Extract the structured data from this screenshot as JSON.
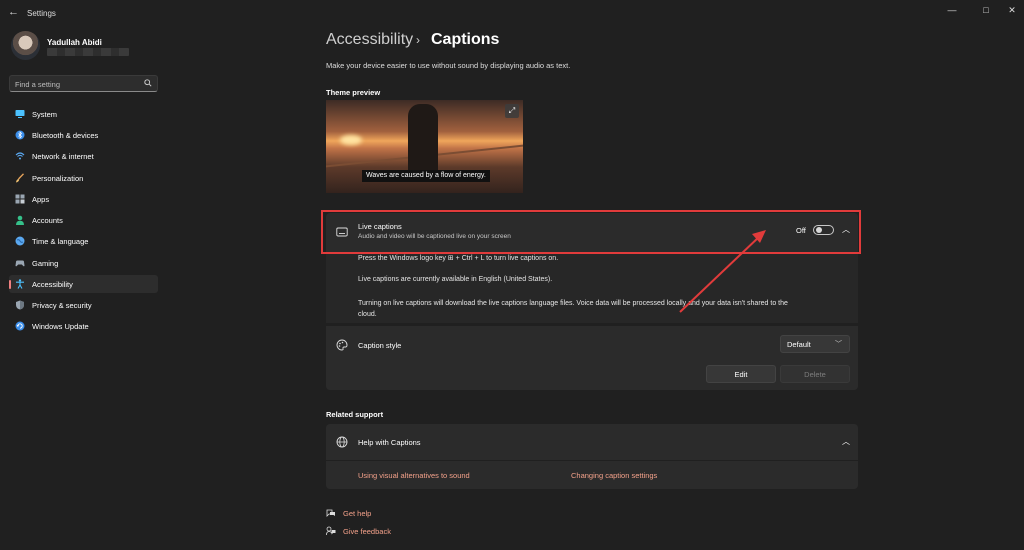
{
  "window": {
    "title": "Settings",
    "controls": {
      "minimize": "—",
      "maximize": "□",
      "close": "✕"
    }
  },
  "profile": {
    "name": "Yadullah Abidi"
  },
  "search": {
    "placeholder": "Find a setting",
    "icon": "search-icon"
  },
  "sidebar": {
    "items": [
      {
        "label": "System",
        "icon": "system-icon",
        "color": "#4cc2ff"
      },
      {
        "label": "Bluetooth & devices",
        "icon": "bluetooth-icon",
        "color": "#3b8eea"
      },
      {
        "label": "Network & internet",
        "icon": "wifi-icon",
        "color": "#5aa8f0"
      },
      {
        "label": "Personalization",
        "icon": "brush-icon",
        "color": "#e6a35a"
      },
      {
        "label": "Apps",
        "icon": "apps-icon",
        "color": "#9aa6b2"
      },
      {
        "label": "Accounts",
        "icon": "accounts-icon",
        "color": "#35c08a"
      },
      {
        "label": "Time & language",
        "icon": "globe-icon",
        "color": "#5aa8f0"
      },
      {
        "label": "Gaming",
        "icon": "gaming-icon",
        "color": "#9aa6b2"
      },
      {
        "label": "Accessibility",
        "icon": "accessibility-icon",
        "color": "#4cc2ff",
        "active": true
      },
      {
        "label": "Privacy & security",
        "icon": "shield-icon",
        "color": "#9aa6b2"
      },
      {
        "label": "Windows Update",
        "icon": "update-icon",
        "color": "#3b8eea"
      }
    ]
  },
  "header": {
    "parent": "Accessibility",
    "separator": "›",
    "current": "Captions",
    "description": "Make your device easier to use without sound by displaying audio as text."
  },
  "theme_preview": {
    "label": "Theme preview",
    "caption": "Waves are caused by a flow of energy.",
    "expand_icon": "expand-icon"
  },
  "live_captions": {
    "title": "Live captions",
    "description": "Audio and video will be captioned live on your screen",
    "toggle_state": "Off",
    "toggle_on": false,
    "info": [
      "Press the Windows logo key ⊞ + Ctrl + L to turn live captions on.",
      "Live captions are currently available in English (United States).",
      "Turning on live captions will download the live captions language files. Voice data will be processed locally and your data isn't shared to the",
      "cloud."
    ]
  },
  "caption_style": {
    "title": "Caption style",
    "selected": "Default",
    "edit_label": "Edit",
    "delete_label": "Delete"
  },
  "related_support": {
    "label": "Related support",
    "help_title": "Help with Captions",
    "links": [
      "Using visual alternatives to sound",
      "Changing caption settings"
    ]
  },
  "footer": {
    "get_help": "Get help",
    "give_feedback": "Give feedback"
  },
  "colors": {
    "accent_link": "#f3a18a",
    "annotation": "#e13b3b",
    "background": "#202020",
    "card": "#2b2b2b"
  }
}
